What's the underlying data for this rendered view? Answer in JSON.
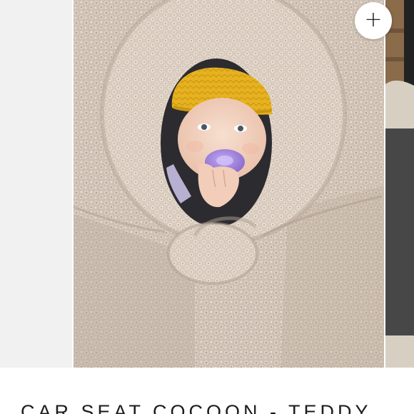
{
  "gallery": {
    "main_image_alt": "Baby wearing a mustard yellow beanie and purple pacifier, wrapped in a hooded teddy sherpa car seat cocoon",
    "add_icon": "plus-icon"
  },
  "product": {
    "title": "CAR SEAT COCOON - TEDDY"
  },
  "colors": {
    "teddy_fabric": "#cdbfb2",
    "beanie": "#e8b21e",
    "pacifier": "#9a7fd8",
    "accent_white": "#ffffff",
    "title_text": "#1c1c1c"
  }
}
